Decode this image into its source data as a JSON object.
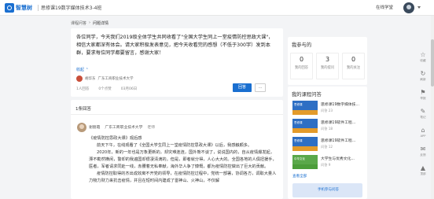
{
  "header": {
    "logo_text": "智慧树",
    "course_title": "思修课19数字媒体技术3-4班",
    "online_label": "在线学堂"
  },
  "breadcrumb": [
    "课程问答",
    "问题详情"
  ],
  "question": {
    "text": "各位同学，今天我们2019级全体学生共同收看了\"全国大学生同上一堂疫情防控思政大课\"，相信大家都深有体会。请大家积极发表意见，把今天收看完的感想（不低于300字）发到本群，要求每位同学都要留言，感谢大家！",
    "collapse_label": "收起",
    "asker_name": "胡华东",
    "asker_school": "广东工商职业技术大学",
    "meta": [
      "1人回答",
      "0个点赞",
      "03月06日"
    ],
    "reply_label": "回答",
    "more_label": "..."
  },
  "answers": {
    "count_label": "1条回答",
    "items": [
      {
        "name": "谢丽霞",
        "school": "广东工商职业技术大学",
        "role": "老师",
        "title": "《疫情防控思政大课》观后感",
        "paragraphs": [
          "前天下午，在线观看了《全国大学生同上一堂疫情防控思政大课》以后，我感触颇多。",
          "2020年，新的一年也是万象更新的，却灾难连连，国外熊不谈了，说说国内的，自从疫情爆发起，漂不勒然横闲，警却的我遍国却很凄清滴的。但是，即者就分得，人心大大的。全国各地的人俱扭援手，医者，军者请求同赴一线，赤腰着无私奉献，海外华人争了慷慨，都为疫情防控做出了巨大的贡献。",
          "疫情防控取得的杰出成效离不开党的领导，在疫情防控过程中，党统一部署，协调各方，调取大量人力物力财力来抗击疫情，并且在短时间内建成了雷神山、火神山，不仅解"
        ]
      }
    ]
  },
  "my_panel": {
    "title": "我参与的",
    "stats": [
      {
        "value": "0",
        "label": "我的回答"
      },
      {
        "value": "3",
        "label": "我的提问"
      },
      {
        "value": "0",
        "label": "我的关注"
      }
    ]
  },
  "course_panel": {
    "title": "我的课程问答",
    "items": [
      {
        "thumb": "思修课",
        "title": "思修课19数字媒体技...",
        "sub": "问答 23"
      },
      {
        "thumb": "思修课",
        "title": "思修课19软件工程...",
        "sub": "问答 18"
      },
      {
        "thumb": "思修课",
        "title": "思修课19软件工程...",
        "sub": "问答 12"
      },
      {
        "thumb": "中华文化",
        "title": "大学生与优秀文化...",
        "sub": "问答 9"
      }
    ],
    "see_all": "查看全部",
    "app_banner": "手机参与问答"
  },
  "rail": [
    {
      "icon": "☆",
      "label": "收藏"
    },
    {
      "icon": "↻",
      "label": "刷新"
    },
    {
      "icon": "⚑",
      "label": "举报"
    },
    {
      "icon": "✎",
      "label": "笔记"
    },
    {
      "icon": "⌂",
      "label": "APP"
    },
    {
      "icon": "✉",
      "label": "反馈"
    },
    {
      "icon": "▲",
      "label": "顶部"
    }
  ]
}
